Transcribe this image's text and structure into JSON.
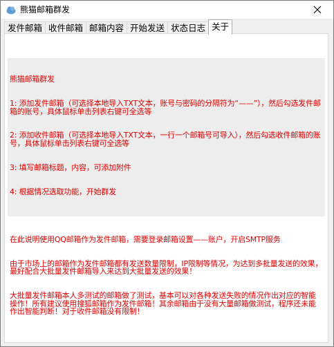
{
  "window": {
    "title": "熊猫邮箱群发",
    "app_icon": "cloud-logo-icon",
    "close_icon": "close-icon"
  },
  "tabs": [
    {
      "label": "发件邮箱",
      "active": false
    },
    {
      "label": "收件邮箱",
      "active": false
    },
    {
      "label": "邮箱内容",
      "active": false
    },
    {
      "label": "开始发送",
      "active": false
    },
    {
      "label": "状态日志",
      "active": false
    },
    {
      "label": "关于",
      "active": true
    }
  ],
  "about": {
    "lines": [
      "熊猫邮箱群发",
      "1: 添加发件邮箱（可选择本地导入TXT文本，账号与密码的分隔符为“——”），然后勾选发件邮箱的账号，具体鼠标单击列表右键可全选等",
      "2: 添加收件邮箱（可选择本地导入TXT文本，一行一个邮箱号可导入），然后勾选收件邮箱的账号，具体鼠标单击列表右键可全选等",
      "3: 填写邮箱标题，内容，可添加附件",
      "4: 根据情况选取功能，开始群发",
      "",
      "在此说明使用QQ邮箱作为发件邮箱，需要登录邮箱设置——账户，开启SMTP服务",
      "由于市场上的邮箱作为发件邮箱都有发送数量限制，IP限制等情况，为达到多批量发送的效果，最好配合大批量发件邮箱导入来达到大批量发送的效果！",
      "大批量发件邮箱本人多测试的邮箱做了测试，基本可以对各种发送失败的情况作出对应的智能操作！所有建议使用搜狐邮箱作为发件邮箱！其余邮箱由于没有大量邮箱做测试，程序还未能作出智能判断！对于收件邮箱没有限制！"
    ]
  }
}
